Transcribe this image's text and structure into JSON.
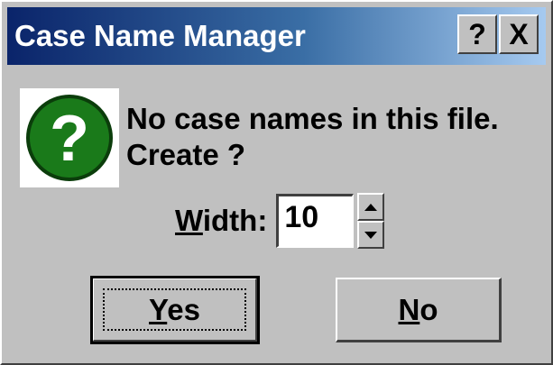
{
  "window": {
    "title": "Case Name Manager",
    "help_button": "?",
    "close_button": "X"
  },
  "message": {
    "line1": "No case names in this file.",
    "line2": "Create ?"
  },
  "width": {
    "label_underlined": "W",
    "label_rest": "idth:",
    "value": "10"
  },
  "buttons": {
    "yes_underlined": "Y",
    "yes_rest": "es",
    "no_underlined": "N",
    "no_rest": "o"
  },
  "icons": {
    "question": "question-icon",
    "spin_up": "arrow-up-icon",
    "spin_down": "arrow-down-icon"
  },
  "colors": {
    "titlebar_start": "#0a246a",
    "titlebar_end": "#a6caf0",
    "question_icon": "#1a7a1a"
  }
}
